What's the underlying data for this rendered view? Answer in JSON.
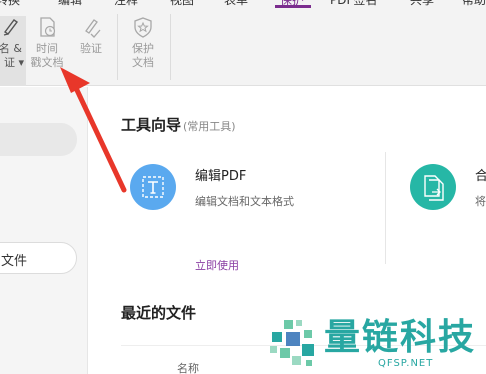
{
  "menu": {
    "items": [
      {
        "label": "转换",
        "active": false
      },
      {
        "label": "编辑",
        "active": false
      },
      {
        "label": "注释",
        "active": false
      },
      {
        "label": "视图",
        "active": false
      },
      {
        "label": "表单",
        "active": false
      },
      {
        "label": "保护",
        "active": true
      },
      {
        "label": "PDF签名",
        "active": false
      },
      {
        "label": "共享",
        "active": false
      },
      {
        "label": "帮助",
        "active": false
      }
    ]
  },
  "ribbon": {
    "sign": {
      "line1": "名 &",
      "line2": "证 ▾"
    },
    "timestamp": {
      "line1": "时间",
      "line2": "戳文档"
    },
    "verify": {
      "label": "验证"
    },
    "protect": {
      "line1": "保护",
      "line2": "文档"
    }
  },
  "left_panel": {
    "open_label": "文件"
  },
  "tools": {
    "title": "工具向导",
    "subtitle": "(常用工具)",
    "items": [
      {
        "name": "编辑PDF",
        "desc": "编辑文档和文本格式",
        "action": "立即使用"
      },
      {
        "name": "合",
        "desc": "将"
      }
    ]
  },
  "recent": {
    "title": "最近的文件",
    "column_name": "名称"
  },
  "watermark": {
    "text": "量链科技",
    "sub": "QFSP.NET"
  },
  "colors": {
    "accent": "#7b2d8e",
    "tool_blue": "#5aa9ef",
    "tool_teal": "#26b7a6",
    "arrow_red": "#e8372a",
    "watermark": "#28a7a2"
  }
}
